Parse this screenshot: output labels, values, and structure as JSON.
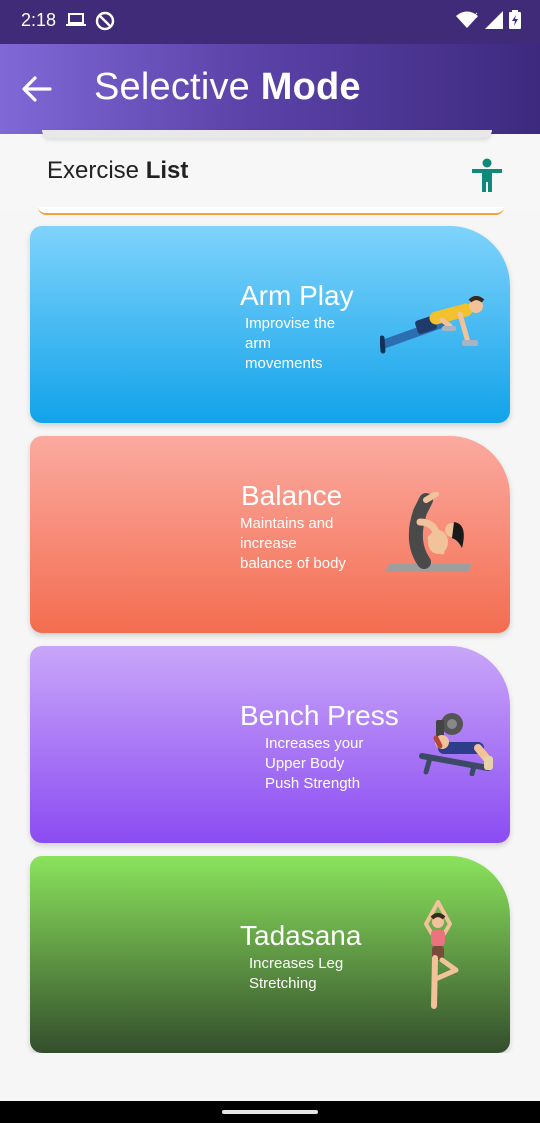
{
  "status_bar": {
    "time": "2:18",
    "left_icons": [
      "laptop-icon",
      "dnd-icon"
    ],
    "right_icons": [
      "wifi-icon",
      "signal-icon",
      "battery-icon"
    ]
  },
  "app_bar": {
    "title_light": "Selective ",
    "title_bold": "Mode",
    "back_icon": "arrow-left-icon"
  },
  "header": {
    "title_light": "Exercise ",
    "title_bold": "List",
    "icon": "accessibility-icon",
    "icon_color": "#0f8a7a"
  },
  "exercises": [
    {
      "title": "Arm Play",
      "desc": "Improvise the arm movements",
      "color_top": "#7fd3fb",
      "color_bottom": "#12a3ea"
    },
    {
      "title": "Balance",
      "desc": "Maintains and increase balance of body",
      "color_top": "#fbaaa0",
      "color_bottom": "#f36d50"
    },
    {
      "title": "Bench Press",
      "desc": "Increases your Upper Body Push Strength",
      "color_top": "#c9a6f9",
      "color_bottom": "#8b4cf2"
    },
    {
      "title": "Tadasana",
      "desc": "Increases Leg Stretching",
      "color_top": "#8be35d",
      "color_bottom": "#344e2c"
    }
  ]
}
